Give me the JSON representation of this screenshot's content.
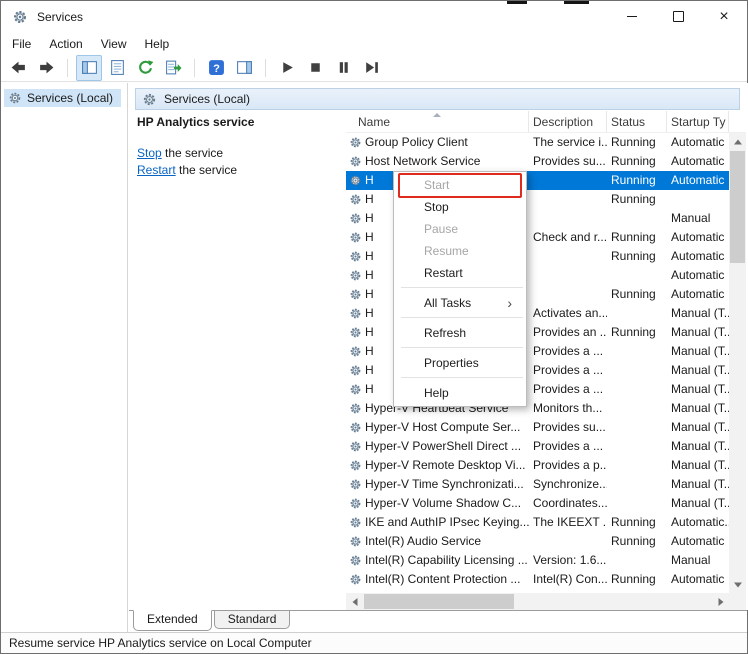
{
  "window": {
    "title": "Services",
    "close_glyph": "×"
  },
  "menu": [
    {
      "label": "File"
    },
    {
      "label": "Action"
    },
    {
      "label": "View"
    },
    {
      "label": "Help"
    }
  ],
  "toolbar": [
    {
      "icon": "back"
    },
    {
      "icon": "forward"
    },
    {
      "sep": true
    },
    {
      "icon": "show-console-tree",
      "pressed": true
    },
    {
      "icon": "properties"
    },
    {
      "icon": "refresh"
    },
    {
      "icon": "export-list"
    },
    {
      "sep": true
    },
    {
      "icon": "help"
    },
    {
      "icon": "show-action-pane"
    },
    {
      "sep": true
    },
    {
      "icon": "start-service"
    },
    {
      "icon": "stop-service"
    },
    {
      "icon": "pause-service"
    },
    {
      "icon": "restart-service"
    }
  ],
  "tree": {
    "root_item": "Services (Local)"
  },
  "content_header": {
    "title": "Services (Local)"
  },
  "detail_pane": {
    "service_name": "HP Analytics service",
    "actions": [
      {
        "link": "Stop",
        "suffix": " the service"
      },
      {
        "link": "Restart",
        "suffix": " the service"
      }
    ]
  },
  "services_table": {
    "columns": [
      "Name",
      "Description",
      "Status",
      "Startup Ty"
    ],
    "sorted_column": "Name",
    "rows": [
      {
        "name": "Group Policy Client",
        "description": "The service i...",
        "status": "Running",
        "startup": "Automatic",
        "selected": false
      },
      {
        "name": "Host Network Service",
        "description": "Provides su...",
        "status": "Running",
        "startup": "Automatic",
        "selected": false
      },
      {
        "name": "H",
        "description": "",
        "status": "Running",
        "startup": "Automatic",
        "selected": true
      },
      {
        "name": "H",
        "description": "",
        "status": "Running",
        "startup": "",
        "selected": false
      },
      {
        "name": "H",
        "description": "",
        "status": "",
        "startup": "Manual",
        "selected": false
      },
      {
        "name": "H",
        "description": "Check and r...",
        "status": "Running",
        "startup": "Automatic",
        "selected": false
      },
      {
        "name": "H",
        "description": "",
        "status": "Running",
        "startup": "Automatic",
        "selected": false
      },
      {
        "name": "H",
        "description": "",
        "status": "",
        "startup": "Automatic",
        "selected": false
      },
      {
        "name": "H",
        "description": "",
        "status": "Running",
        "startup": "Automatic",
        "selected": false
      },
      {
        "name": "H",
        "description": "Activates an...",
        "status": "",
        "startup": "Manual (T...",
        "selected": false
      },
      {
        "name": "H",
        "description": "Provides an ...",
        "status": "Running",
        "startup": "Manual (T...",
        "selected": false
      },
      {
        "name": "H",
        "description": "Provides a ...",
        "status": "",
        "startup": "Manual (T...",
        "selected": false
      },
      {
        "name": "H",
        "description": "Provides a ...",
        "status": "",
        "startup": "Manual (T...",
        "selected": false
      },
      {
        "name": "H",
        "description": "Provides a ...",
        "status": "",
        "startup": "Manual (T...",
        "selected": false
      },
      {
        "name": "Hyper-V Heartbeat Service",
        "description": "Monitors th...",
        "status": "",
        "startup": "Manual (T...",
        "selected": false
      },
      {
        "name": "Hyper-V Host Compute Ser...",
        "description": "Provides su...",
        "status": "",
        "startup": "Manual (T...",
        "selected": false
      },
      {
        "name": "Hyper-V PowerShell Direct ...",
        "description": "Provides a ...",
        "status": "",
        "startup": "Manual (T...",
        "selected": false
      },
      {
        "name": "Hyper-V Remote Desktop Vi...",
        "description": "Provides a p...",
        "status": "",
        "startup": "Manual (T...",
        "selected": false
      },
      {
        "name": "Hyper-V Time Synchronizati...",
        "description": "Synchronize...",
        "status": "",
        "startup": "Manual (T...",
        "selected": false
      },
      {
        "name": "Hyper-V Volume Shadow C...",
        "description": "Coordinates...",
        "status": "",
        "startup": "Manual (T...",
        "selected": false
      },
      {
        "name": "IKE and AuthIP IPsec Keying...",
        "description": "The IKEEXT ...",
        "status": "Running",
        "startup": "Automatic...",
        "selected": false
      },
      {
        "name": "Intel(R) Audio Service",
        "description": "",
        "status": "Running",
        "startup": "Automatic",
        "selected": false
      },
      {
        "name": "Intel(R) Capability Licensing ...",
        "description": "Version: 1.6...",
        "status": "",
        "startup": "Manual",
        "selected": false
      },
      {
        "name": "Intel(R) Content Protection ...",
        "description": "Intel(R) Con...",
        "status": "Running",
        "startup": "Automatic",
        "selected": false
      }
    ]
  },
  "context_menu": {
    "submenu_arrow": "›",
    "items": [
      {
        "label": "Start",
        "disabled": true,
        "annotated": true
      },
      {
        "label": "Stop",
        "disabled": false
      },
      {
        "label": "Pause",
        "disabled": true
      },
      {
        "label": "Resume",
        "disabled": true
      },
      {
        "label": "Restart",
        "disabled": false
      },
      {
        "sep": true
      },
      {
        "label": "All Tasks",
        "disabled": false,
        "submenu": true
      },
      {
        "sep": true
      },
      {
        "label": "Refresh",
        "disabled": false
      },
      {
        "sep": true
      },
      {
        "label": "Properties",
        "disabled": false
      },
      {
        "sep": true
      },
      {
        "label": "Help",
        "disabled": false
      }
    ]
  },
  "tabs": [
    {
      "label": "Extended",
      "active": true
    },
    {
      "label": "Standard",
      "active": false
    }
  ],
  "status_bar": {
    "text": "Resume service HP Analytics service on Local Computer"
  },
  "colors": {
    "selection": "#0078d7",
    "link": "#0a64c2",
    "annotation_red": "#e02a1d",
    "header_band": "#d9e7f6"
  }
}
